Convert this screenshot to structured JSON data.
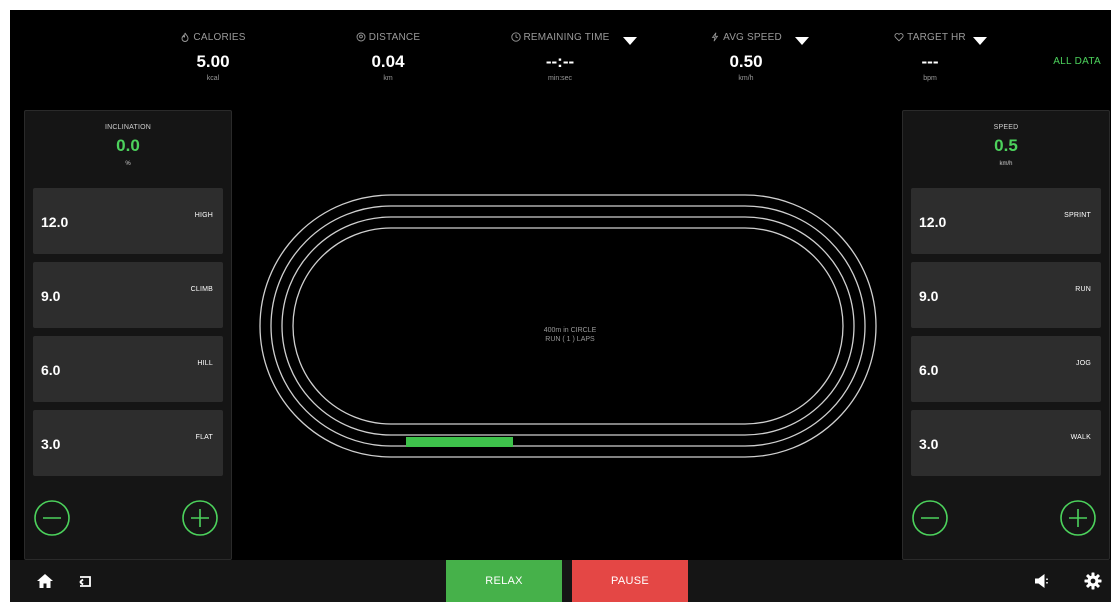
{
  "metrics": {
    "calories": {
      "label": "CALORIES",
      "value": "5.00",
      "unit": "kcal"
    },
    "distance": {
      "label": "DISTANCE",
      "value": "0.04",
      "unit": "km"
    },
    "remaining_time": {
      "label": "REMAINING TIME",
      "value": "--:--",
      "unit": "min:sec"
    },
    "avg_speed": {
      "label": "AVG SPEED",
      "value": "0.50",
      "unit": "km/h"
    },
    "target_hr": {
      "label": "TARGET HR",
      "value": "---",
      "unit": "bpm"
    }
  },
  "all_data_label": "ALL DATA",
  "inclination": {
    "title": "INCLINATION",
    "value": "0.0",
    "unit": "%",
    "presets": [
      {
        "value": "12.0",
        "label": "HIGH"
      },
      {
        "value": "9.0",
        "label": "CLIMB"
      },
      {
        "value": "6.0",
        "label": "HILL"
      },
      {
        "value": "3.0",
        "label": "FLAT"
      }
    ]
  },
  "speed": {
    "title": "SPEED",
    "value": "0.5",
    "unit": "km/h",
    "presets": [
      {
        "value": "12.0",
        "label": "SPRINT"
      },
      {
        "value": "9.0",
        "label": "RUN"
      },
      {
        "value": "6.0",
        "label": "JOG"
      },
      {
        "value": "3.0",
        "label": "WALK"
      }
    ]
  },
  "track": {
    "line1": "400m in CIRCLE",
    "line2": "RUN ( 1 ) LAPS",
    "progress_color": "#3ec24b"
  },
  "bottom": {
    "relax_label": "RELAX",
    "pause_label": "PAUSE"
  },
  "colors": {
    "accent_green": "#4cd25c",
    "relax_green": "#46b14a",
    "pause_red": "#e44745"
  },
  "icons": [
    "flame-icon",
    "location-icon",
    "clock-icon",
    "speed-icon",
    "heart-icon",
    "home-icon",
    "back-icon",
    "volume-icon",
    "settings-icon",
    "minus-icon",
    "plus-icon"
  ]
}
